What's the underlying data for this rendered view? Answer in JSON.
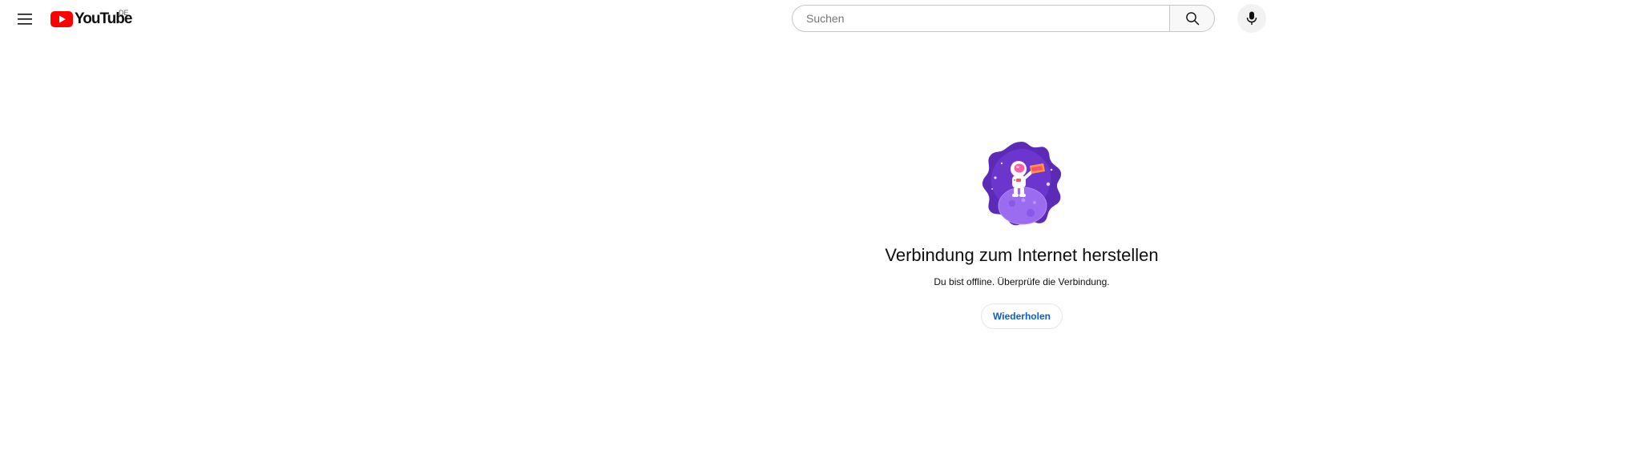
{
  "header": {
    "menu_icon": "hamburger-menu-icon",
    "logo": {
      "icon": "youtube-play-icon",
      "wordmark": "YouTube",
      "country_code": "DE",
      "brand_color": "#ff0000"
    },
    "search": {
      "placeholder": "Suchen",
      "value": "",
      "button_icon": "search-icon"
    },
    "mic_icon": "microphone-icon"
  },
  "offline": {
    "illustration": "astronaut-on-planet-illustration",
    "title": "Verbindung zum Internet herstellen",
    "message": "Du bist offline. Überprüfe die Verbindung.",
    "retry_label": "Wiederholen",
    "accent_color": "#6a2fd1",
    "link_color": "#065fd4"
  }
}
